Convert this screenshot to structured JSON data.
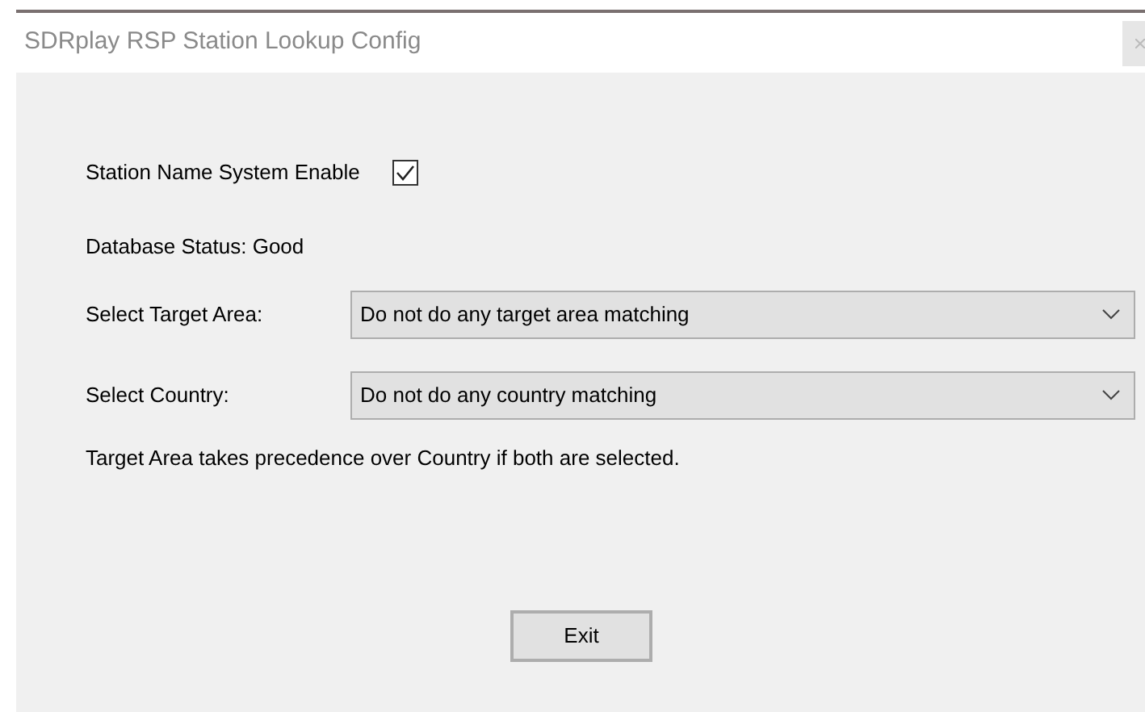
{
  "window": {
    "title": "SDRplay RSP Station Lookup Config"
  },
  "enable": {
    "label": "Station Name System Enable",
    "checked": true
  },
  "status": "Database Status: Good",
  "selects": [
    {
      "label": "Select Target Area:",
      "value": "Do not do any target area matching"
    },
    {
      "label": "Select Country:",
      "value": "Do not do any country matching"
    }
  ],
  "note": "Target Area takes precedence over Country if both are selected.",
  "buttons": [
    "Exit"
  ]
}
